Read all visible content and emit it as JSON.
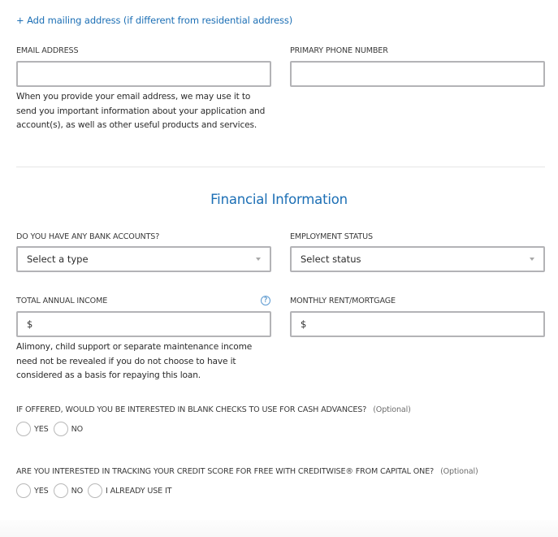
{
  "mailing_link": "+ Add mailing address (if different from residential address)",
  "contact": {
    "email": {
      "label": "EMAIL ADDRESS",
      "value": "",
      "helper_lines": [
        "When you provide your email address, we may use it to",
        "send you important information about your application and",
        "account(s), as well as other useful products and services."
      ]
    },
    "phone": {
      "label": "PRIMARY PHONE NUMBER",
      "value": ""
    }
  },
  "financial": {
    "title": "Financial Information",
    "bank_accounts": {
      "label": "DO YOU HAVE ANY BANK ACCOUNTS?",
      "selected": "Select a type"
    },
    "employment": {
      "label": "EMPLOYMENT STATUS",
      "selected": "Select status"
    },
    "income": {
      "label": "TOTAL ANNUAL INCOME",
      "prefix": "$",
      "help_icon": "?",
      "helper_lines": [
        "Alimony, child support or separate maintenance income",
        "need not be revealed if you do not choose to have it",
        "considered as a basis for repaying this loan."
      ]
    },
    "rent": {
      "label": "MONTHLY RENT/MORTGAGE",
      "prefix": "$"
    },
    "blank_checks": {
      "question": "IF OFFERED, WOULD YOU BE INTERESTED IN BLANK CHECKS TO USE FOR CASH ADVANCES?",
      "optional": "(Optional)",
      "options": [
        "YES",
        "NO"
      ]
    },
    "creditwise": {
      "question": "ARE YOU INTERESTED IN TRACKING YOUR CREDIT SCORE FOR FREE WITH CREDITWISE® FROM CAPITAL ONE?",
      "optional": "(Optional)",
      "options": [
        "YES",
        "NO",
        "I ALREADY USE IT"
      ]
    }
  },
  "colors": {
    "accent": "#1c6fb5",
    "input_border": "#b3b3b6",
    "divider": "#e6e6e6"
  }
}
